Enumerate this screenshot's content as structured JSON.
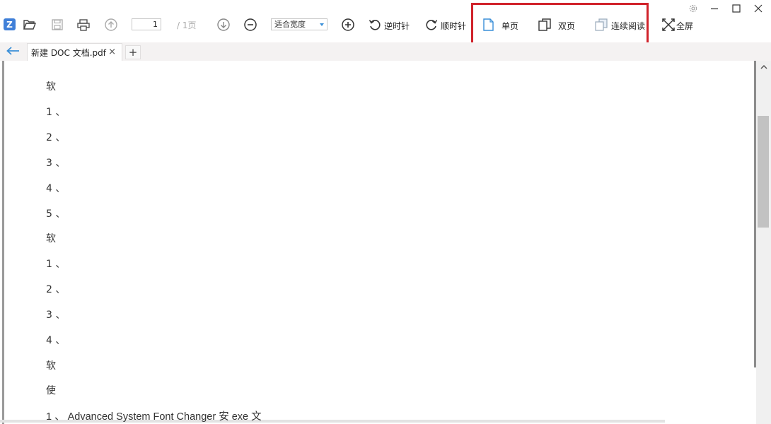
{
  "toolbar": {
    "app_logo": "Z",
    "page_current": "1",
    "page_total": "/ 1页",
    "zoom_value": "适合宽度",
    "rotate_ccw_label": "逆时针",
    "rotate_cw_label": "顺时针",
    "single_page_label": "单页",
    "double_page_label": "双页",
    "continuous_label": "连续阅读",
    "fullscreen_label": "全屏",
    "highlight_color": "#d0222a",
    "accent_color": "#3a8fd8"
  },
  "tabs": {
    "active_tab": "新建 DOC 文档.pdf",
    "close_glyph": "×",
    "add_glyph": "+"
  },
  "document": {
    "lines": [
      "软",
      "1 、",
      "2 、",
      "3 、",
      "4 、",
      "5 、",
      "软",
      "1 、",
      "2 、",
      "3 、",
      "4 、",
      "软",
      "使",
      "1 、 Advanced System Font Changer 安 exe 文"
    ]
  }
}
